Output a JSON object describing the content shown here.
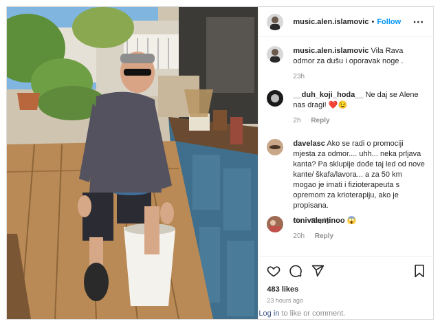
{
  "post": {
    "header": {
      "username": "music.alen.islamovic",
      "separator": "•",
      "follow_label": "Follow",
      "more_icon": "more-horizontal-icon"
    },
    "comments": [
      {
        "username": "music.alen.islamovic",
        "text": "Vila Rava odmor za dušu i oporavak noge .",
        "time": "23h"
      },
      {
        "username": "__duh_koji_hoda__",
        "text": "Ne daj se Alene nas dragi!",
        "emoji": "❤️😉",
        "time": "2h",
        "reply_label": "Reply"
      },
      {
        "username": "davelasc",
        "text": "Ako se radi o promociji mjesta za odmor.... uhh... neka prljava kanta? Pa sklupije dođe taj led od nove kante/ škafa/lavora... a za 50 km mogao je imati i fizioterapeuta s opremom za krioterapiju, ako je propisana.",
        "time": "6h",
        "reply_label": "Reply"
      },
      {
        "username": "tonivalentinoo",
        "emoji": "😱",
        "time": "20h",
        "reply_label": "Reply"
      }
    ],
    "actions": {
      "like_icon": "heart-icon",
      "comment_icon": "comment-icon",
      "share_icon": "send-icon",
      "save_icon": "bookmark-icon"
    },
    "likes": "483 likes",
    "posted_ago": "23 hours ago",
    "login_prompt": {
      "link": "Log in",
      "rest": " to like or comment."
    }
  }
}
